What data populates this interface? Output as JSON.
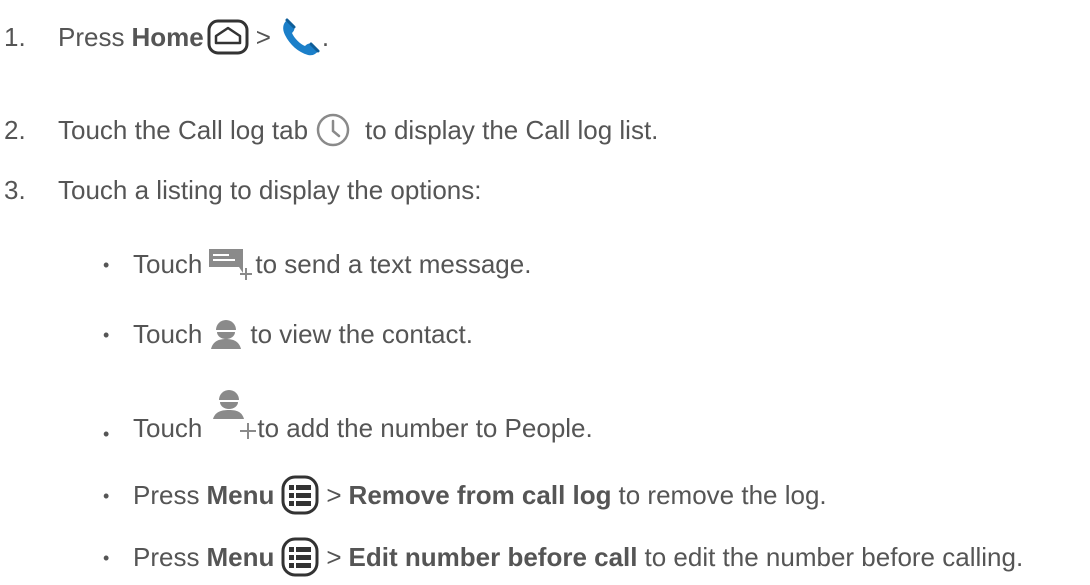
{
  "steps": [
    {
      "number": "1.",
      "press": "Press",
      "home": "Home",
      "sep": ">",
      "end": "."
    },
    {
      "number": "2.",
      "text_before": "Touch the Call log tab",
      "text_after": "to display the Call log list."
    },
    {
      "number": "3.",
      "text": "Touch a listing to display the options:"
    }
  ],
  "options": [
    {
      "bullet": "•",
      "prefix": "Touch",
      "suffix": "to send a text message.",
      "icon": "new-message-icon"
    },
    {
      "bullet": "•",
      "prefix": "Touch",
      "suffix": "to view the contact.",
      "icon": "contact-icon"
    },
    {
      "bullet": "•",
      "prefix": "Touch",
      "suffix": "to add the number to People.",
      "icon": "add-contact-icon"
    },
    {
      "bullet": "•",
      "prefix": "Press",
      "menu": "Menu",
      "sep": ">",
      "action": "Remove from call log",
      "suffix": "to remove the log.",
      "icon": "menu-icon"
    },
    {
      "bullet": "•",
      "prefix": "Press",
      "menu": "Menu",
      "sep": ">",
      "action": "Edit number before call",
      "suffix": "to edit the number before calling.",
      "icon": "menu-icon"
    }
  ],
  "colors": {
    "text": "#555555",
    "phone": "#1b7fc9",
    "icon_gray": "#8a8a8a"
  }
}
